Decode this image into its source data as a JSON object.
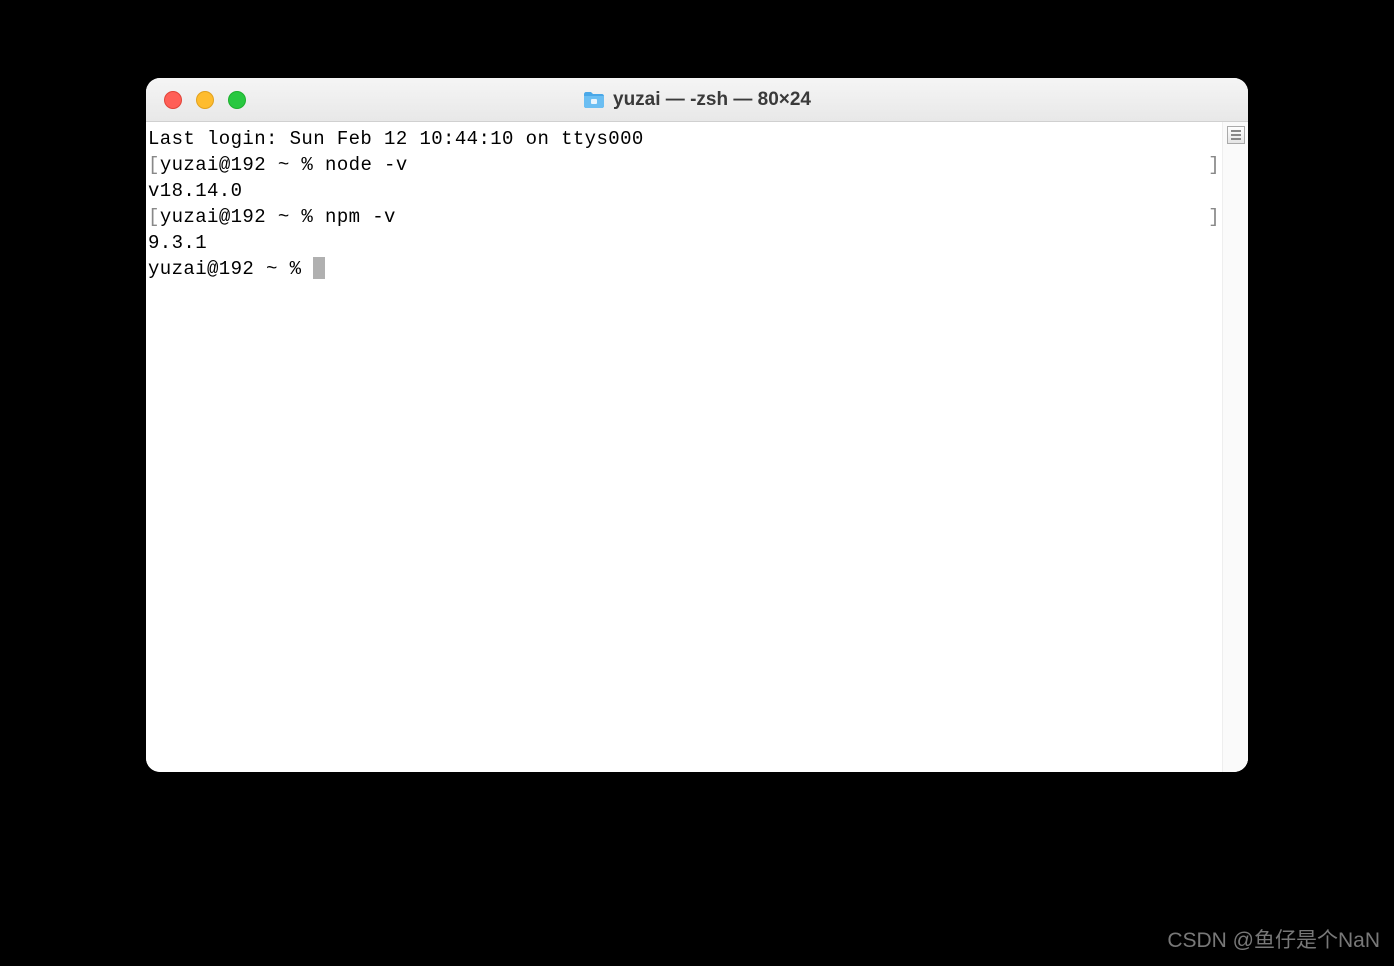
{
  "window": {
    "title": "yuzai — -zsh — 80×24"
  },
  "terminal": {
    "lines": [
      {
        "left_bracket": "",
        "text": "Last login: Sun Feb 12 10:44:10 on ttys000",
        "right_bracket": ""
      },
      {
        "left_bracket": "[",
        "text": "yuzai@192 ~ % node -v",
        "right_bracket": "]"
      },
      {
        "left_bracket": "",
        "text": "v18.14.0",
        "right_bracket": ""
      },
      {
        "left_bracket": "[",
        "text": "yuzai@192 ~ % npm -v",
        "right_bracket": "]"
      },
      {
        "left_bracket": "",
        "text": "9.3.1",
        "right_bracket": ""
      }
    ],
    "current_prompt": "yuzai@192 ~ % "
  },
  "watermark": "CSDN @鱼仔是个NaN"
}
